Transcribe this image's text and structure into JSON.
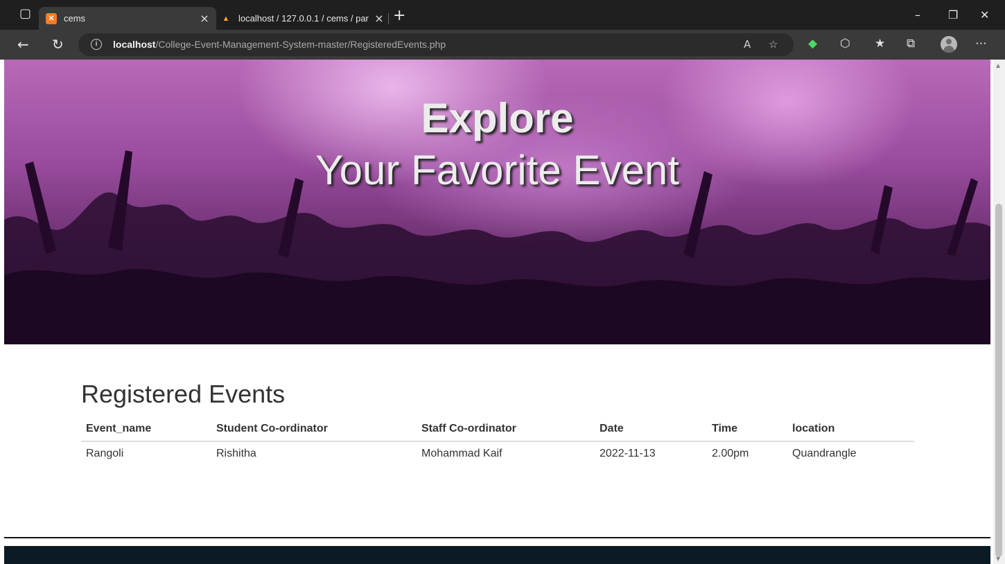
{
  "browser": {
    "tabs": [
      {
        "title": "cems",
        "favicon": "xampp-icon",
        "active": true
      },
      {
        "title": "localhost / 127.0.0.1 / cems / par",
        "favicon": "phpmyadmin-icon",
        "active": false
      }
    ],
    "new_tab_label": "+",
    "url_host": "localhost",
    "url_path": "/College-Event-Management-System-master/RegisteredEvents.php",
    "colors": {
      "titlebar": "#1f1f1f",
      "toolbar": "#3a3a3a"
    }
  },
  "hero": {
    "line1": "Explore",
    "line2": "Your Favorite Event"
  },
  "registered": {
    "title": "Registered Events",
    "columns": [
      "Event_name",
      "Student Co-ordinator",
      "Staff Co-ordinator",
      "Date",
      "Time",
      "location"
    ],
    "rows": [
      [
        "Rangoli",
        "Rishitha",
        "Mohammad Kaif",
        "2022-11-13",
        "2.00pm",
        "Quandrangle"
      ]
    ]
  }
}
